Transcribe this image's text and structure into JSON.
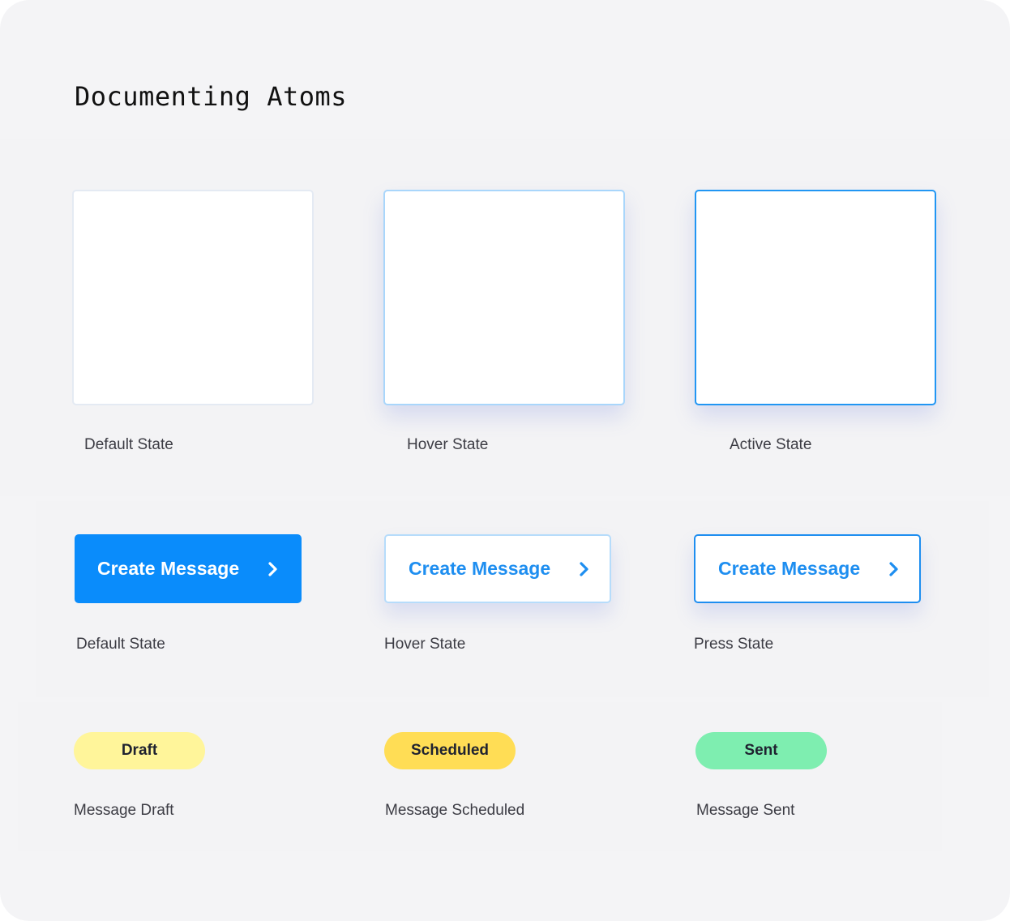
{
  "page": {
    "title": "Documenting Atoms"
  },
  "cards": [
    {
      "state": "default",
      "label": "Default State",
      "border_color": "#e4eaf3"
    },
    {
      "state": "hover",
      "label": "Hover State",
      "border_color": "#a9d6fb"
    },
    {
      "state": "active",
      "label": "Active State",
      "border_color": "#2196f3"
    }
  ],
  "buttons": [
    {
      "state": "default",
      "text": "Create Message",
      "icon": "chevron-right-icon",
      "caption": "Default State",
      "background": "#0a8cfb",
      "text_color": "#ffffff"
    },
    {
      "state": "hover",
      "text": "Create Message",
      "icon": "chevron-right-icon",
      "caption": "Hover State",
      "background": "#ffffff",
      "text_color": "#1e8ef0"
    },
    {
      "state": "press",
      "text": "Create Message",
      "icon": "chevron-right-icon",
      "caption": "Press State",
      "background": "#ffffff",
      "text_color": "#1e8ef0"
    }
  ],
  "badges": [
    {
      "text": "Draft",
      "caption": "Message Draft",
      "color": "#fff59a"
    },
    {
      "text": "Scheduled",
      "caption": "Message Scheduled",
      "color": "#ffdd55"
    },
    {
      "text": "Sent",
      "caption": "Message Sent",
      "color": "#7eeeb0"
    }
  ]
}
